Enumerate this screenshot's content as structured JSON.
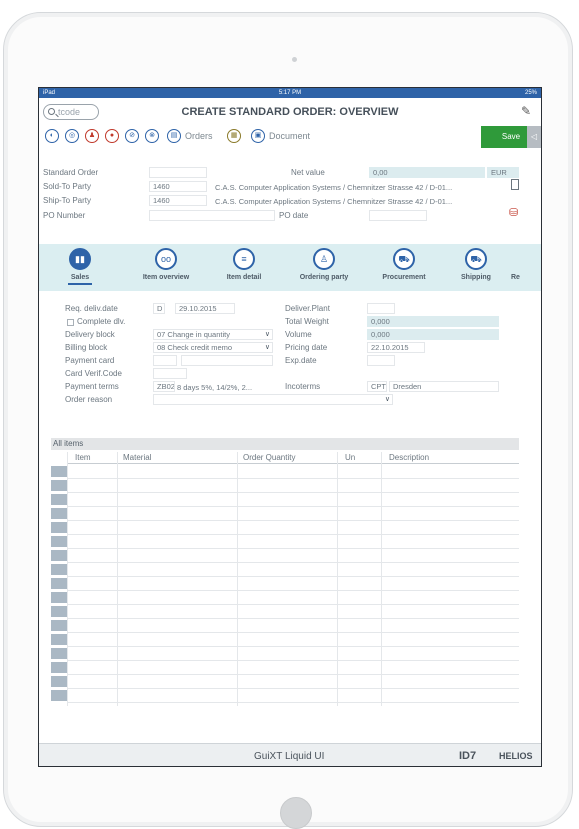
{
  "status": {
    "carrier": "iPad",
    "time": "5:17 PM",
    "battery": "25%"
  },
  "header": {
    "tcode_placeholder": "tcode",
    "title": "CREATE STANDARD ORDER: OVERVIEW"
  },
  "toolbar": {
    "orders_label": "Orders",
    "document_label": "Document",
    "save_label": "Save"
  },
  "order_header": {
    "standard_order_label": "Standard Order",
    "standard_order_value": "",
    "net_value_label": "Net value",
    "net_value": "0,00",
    "currency": "EUR",
    "sold_to_label": "Sold-To Party",
    "sold_to_value": "1460",
    "sold_to_desc": "C.A.S. Computer Application Systems / Chemnitzer Strasse 42 / D-01...",
    "ship_to_label": "Ship-To Party",
    "ship_to_value": "1460",
    "ship_to_desc": "C.A.S. Computer Application Systems / Chemnitzer Strasse 42 / D-01...",
    "po_number_label": "PO Number",
    "po_number_value": "",
    "po_date_label": "PO date",
    "po_date_value": ""
  },
  "tabs": [
    {
      "label": "Sales",
      "icon": "sales-icon",
      "glyph": "▮▮"
    },
    {
      "label": "Item overview",
      "icon": "binoculars-icon",
      "glyph": "oo"
    },
    {
      "label": "Item detail",
      "icon": "clipboard-icon",
      "glyph": "≡"
    },
    {
      "label": "Ordering party",
      "icon": "person-icon",
      "glyph": "♙"
    },
    {
      "label": "Procurement",
      "icon": "cart-icon",
      "glyph": "⛟"
    },
    {
      "label": "Shipping",
      "icon": "truck-icon",
      "glyph": "⛟"
    },
    {
      "label": "Re",
      "icon": "",
      "glyph": ""
    }
  ],
  "sales": {
    "req_deliv_label": "Req. deliv.date",
    "req_deliv_type": "D",
    "req_deliv_value": "29.10.2015",
    "deliver_plant_label": "Deliver.Plant",
    "deliver_plant_value": "",
    "complete_dlv_label": "Complete dlv.",
    "total_weight_label": "Total Weight",
    "total_weight_value": "0,000",
    "delivery_block_label": "Delivery block",
    "delivery_block_value": "07 Change in quantity",
    "volume_label": "Volume",
    "volume_value": "0,000",
    "billing_block_label": "Billing block",
    "billing_block_value": "08 Check credit memo",
    "pricing_date_label": "Pricing date",
    "pricing_date_value": "22.10.2015",
    "payment_card_label": "Payment card",
    "exp_date_label": "Exp.date",
    "card_verif_label": "Card Verif.Code",
    "payment_terms_label": "Payment terms",
    "payment_terms_code": "ZB02",
    "payment_terms_desc": "8 days 5%, 14/2%, 2...",
    "incoterms_label": "Incoterms",
    "incoterms_code": "CPT",
    "incoterms_place": "Dresden",
    "order_reason_label": "Order reason",
    "order_reason_value": ""
  },
  "items": {
    "section_label": "All items",
    "columns": [
      "Item",
      "Material",
      "Order Quantity",
      "Un",
      "Description"
    ],
    "row_count": 17
  },
  "footer": {
    "brand": "GuiXT Liquid UI",
    "id": "ID7",
    "helios": "HELIOS"
  }
}
